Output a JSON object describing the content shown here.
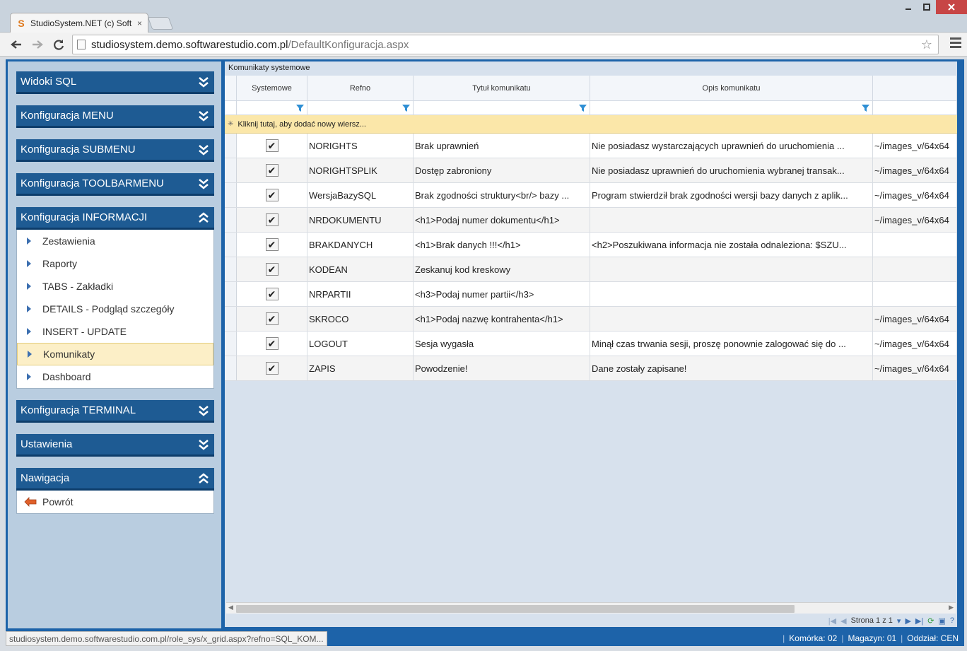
{
  "browser": {
    "tab_title": "StudioSystem.NET (c) Soft",
    "tab_close": "×",
    "url_host": "studiosystem.demo.softwarestudio.com.pl",
    "url_path": "/DefaultKonfiguracja.aspx",
    "status_url": "studiosystem.demo.softwarestudio.com.pl/role_sys/x_grid.aspx?refno=SQL_KOM..."
  },
  "sidebar": {
    "sections": [
      {
        "title": "Widoki SQL",
        "expanded": false
      },
      {
        "title": "Konfiguracja MENU",
        "expanded": false
      },
      {
        "title": "Konfiguracja SUBMENU",
        "expanded": false
      },
      {
        "title": "Konfiguracja TOOLBARMENU",
        "expanded": false
      },
      {
        "title": "Konfiguracja INFORMACJI",
        "expanded": true,
        "items": [
          "Zestawienia",
          "Raporty",
          "TABS - Zakładki",
          "DETAILS - Podgląd szczegóły",
          "INSERT - UPDATE",
          "Komunikaty",
          "Dashboard"
        ],
        "active_item": "Komunikaty"
      },
      {
        "title": "Konfiguracja TERMINAL",
        "expanded": false
      },
      {
        "title": "Ustawienia",
        "expanded": false
      },
      {
        "title": "Nawigacja",
        "expanded": true,
        "items": [
          "Powrót"
        ]
      }
    ]
  },
  "grid": {
    "panel_title": "Komunikaty systemowe",
    "columns": [
      "Systemowe",
      "Refno",
      "Tytuł komunikatu",
      "Opis komunikatu",
      ""
    ],
    "add_row_text": "Kliknij tutaj, aby dodać nowy wiersz...",
    "rows": [
      {
        "systemowe": true,
        "refno": "NORIGHTS",
        "tytul": "Brak uprawnień",
        "opis": "Nie posiadasz wystarczających uprawnień do uruchomienia ...",
        "img": "~/images_v/64x64"
      },
      {
        "systemowe": true,
        "refno": "NORIGHTSPLIK",
        "tytul": "Dostęp zabroniony",
        "opis": "Nie posiadasz uprawnień do uruchomienia wybranej transak...",
        "img": "~/images_v/64x64"
      },
      {
        "systemowe": true,
        "refno": "WersjaBazySQL",
        "tytul": "Brak zgodności struktury<br/> bazy ...",
        "opis": "Program stwierdził brak zgodności wersji bazy danych z aplik...",
        "img": "~/images_v/64x64"
      },
      {
        "systemowe": true,
        "refno": "NRDOKUMENTU",
        "tytul": "<h1>Podaj numer dokumentu</h1>",
        "opis": "",
        "img": "~/images_v/64x64"
      },
      {
        "systemowe": true,
        "refno": "BRAKDANYCH",
        "tytul": "<h1>Brak danych !!!</h1>",
        "opis": "<h2>Poszukiwana informacja nie została odnaleziona: $SZU...",
        "img": ""
      },
      {
        "systemowe": true,
        "refno": "KODEAN",
        "tytul": "Zeskanuj kod kreskowy",
        "opis": "",
        "img": ""
      },
      {
        "systemowe": true,
        "refno": "NRPARTII",
        "tytul": "<h3>Podaj numer partii</h3>",
        "opis": "",
        "img": ""
      },
      {
        "systemowe": true,
        "refno": "SKROCO",
        "tytul": "<h1>Podaj nazwę kontrahenta</h1>",
        "opis": "",
        "img": "~/images_v/64x64"
      },
      {
        "systemowe": true,
        "refno": "LOGOUT",
        "tytul": "Sesja wygasła",
        "opis": "Minął czas trwania sesji, proszę ponownie zalogować się do ...",
        "img": "~/images_v/64x64"
      },
      {
        "systemowe": true,
        "refno": "ZAPIS",
        "tytul": "Powodzenie!",
        "opis": "Dane zostały zapisane!",
        "img": "~/images_v/64x64"
      }
    ],
    "pager_text": "Strona 1 z 1"
  },
  "status": {
    "komorka": "Komórka: 02",
    "magazyn": "Magazyn: 01",
    "oddzial": "Oddział: CEN"
  },
  "colors": {
    "accent": "#1e5b93",
    "active_row": "#fcefc7",
    "add_row": "#fbe7a9"
  }
}
